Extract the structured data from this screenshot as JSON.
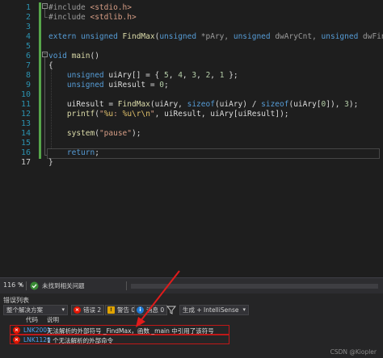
{
  "editor": {
    "line_numbers": [
      "1",
      "2",
      "3",
      "4",
      "5",
      "6",
      "7",
      "8",
      "9",
      "10",
      "11",
      "12",
      "13",
      "14",
      "15",
      "16",
      "17"
    ],
    "current_line": "17",
    "lines": [
      [
        {
          "t": "#include ",
          "c": "pp"
        },
        {
          "t": "<stdio.h>",
          "c": "str"
        }
      ],
      [
        {
          "t": "#include ",
          "c": "pp"
        },
        {
          "t": "<stdlib.h>",
          "c": "str"
        }
      ],
      [],
      [
        {
          "t": "extern ",
          "c": "kw"
        },
        {
          "t": "unsigned ",
          "c": "kw"
        },
        {
          "t": "FindMax",
          "c": "fn"
        },
        {
          "t": "(",
          "c": "var"
        },
        {
          "t": "unsigned ",
          "c": "kw"
        },
        {
          "t": "*pAry, ",
          "c": "pr"
        },
        {
          "t": "unsigned ",
          "c": "kw"
        },
        {
          "t": "dwAryCnt, ",
          "c": "pr"
        },
        {
          "t": "unsigned ",
          "c": "kw"
        },
        {
          "t": "dwFind);",
          "c": "pr"
        }
      ],
      [],
      [
        {
          "t": "void ",
          "c": "kw"
        },
        {
          "t": "main",
          "c": "fn"
        },
        {
          "t": "()",
          "c": "var"
        }
      ],
      [
        {
          "t": "{",
          "c": "var"
        }
      ],
      [
        {
          "t": "    unsigned ",
          "c": "kw"
        },
        {
          "t": "uiAry[] = { ",
          "c": "var"
        },
        {
          "t": "5",
          "c": "num"
        },
        {
          "t": ", ",
          "c": "var"
        },
        {
          "t": "4",
          "c": "num"
        },
        {
          "t": ", ",
          "c": "var"
        },
        {
          "t": "3",
          "c": "num"
        },
        {
          "t": ", ",
          "c": "var"
        },
        {
          "t": "2",
          "c": "num"
        },
        {
          "t": ", ",
          "c": "var"
        },
        {
          "t": "1",
          "c": "num"
        },
        {
          "t": " };",
          "c": "var"
        }
      ],
      [
        {
          "t": "    unsigned ",
          "c": "kw"
        },
        {
          "t": "uiResult = ",
          "c": "var"
        },
        {
          "t": "0",
          "c": "num"
        },
        {
          "t": ";",
          "c": "var"
        }
      ],
      [],
      [
        {
          "t": "    uiResult = ",
          "c": "var"
        },
        {
          "t": "FindMax",
          "c": "fn"
        },
        {
          "t": "(uiAry, ",
          "c": "var"
        },
        {
          "t": "sizeof",
          "c": "kw"
        },
        {
          "t": "(uiAry) / ",
          "c": "var"
        },
        {
          "t": "sizeof",
          "c": "kw"
        },
        {
          "t": "(uiAry[",
          "c": "var"
        },
        {
          "t": "0",
          "c": "num"
        },
        {
          "t": "]), ",
          "c": "var"
        },
        {
          "t": "3",
          "c": "num"
        },
        {
          "t": ");",
          "c": "var"
        }
      ],
      [
        {
          "t": "    ",
          "c": "var"
        },
        {
          "t": "printf",
          "c": "fn"
        },
        {
          "t": "(",
          "c": "var"
        },
        {
          "t": "\"",
          "c": "str"
        },
        {
          "t": "%u",
          "c": "esc"
        },
        {
          "t": ": ",
          "c": "str"
        },
        {
          "t": "%u\\r\\n",
          "c": "esc"
        },
        {
          "t": "\"",
          "c": "str"
        },
        {
          "t": ", uiResult, uiAry[uiResult]);",
          "c": "var"
        }
      ],
      [],
      [
        {
          "t": "    ",
          "c": "var"
        },
        {
          "t": "system",
          "c": "fn"
        },
        {
          "t": "(",
          "c": "var"
        },
        {
          "t": "\"pause\"",
          "c": "str"
        },
        {
          "t": ");",
          "c": "var"
        }
      ],
      [],
      [
        {
          "t": "    ",
          "c": "var"
        },
        {
          "t": "return",
          "c": "kw"
        },
        {
          "t": ";",
          "c": "var"
        }
      ],
      [
        {
          "t": "}",
          "c": "var"
        }
      ]
    ]
  },
  "status_bar": {
    "zoom": "116 %",
    "health_text": "未找到相关问题"
  },
  "error_list": {
    "title": "错误列表",
    "scope": "整个解决方案",
    "errors_button": "错误 2",
    "warnings_button": "警告 0",
    "messages_button": "消息 0",
    "source": "生成 + IntelliSense",
    "columns": [
      "代码",
      "说明"
    ],
    "rows": [
      {
        "code": "LNK2001",
        "description": "无法解析的外部符号 _FindMax，函数 _main 中引用了该符号"
      },
      {
        "code": "LNK1120",
        "description": "1 个无法解析的外部命令"
      }
    ]
  },
  "watermark": "CSDN @Kiopler",
  "colors": {
    "error": "#e51400",
    "warning": "#e0a300",
    "info": "#1e7bd6",
    "annotation_arrow": "#e01b1b"
  }
}
